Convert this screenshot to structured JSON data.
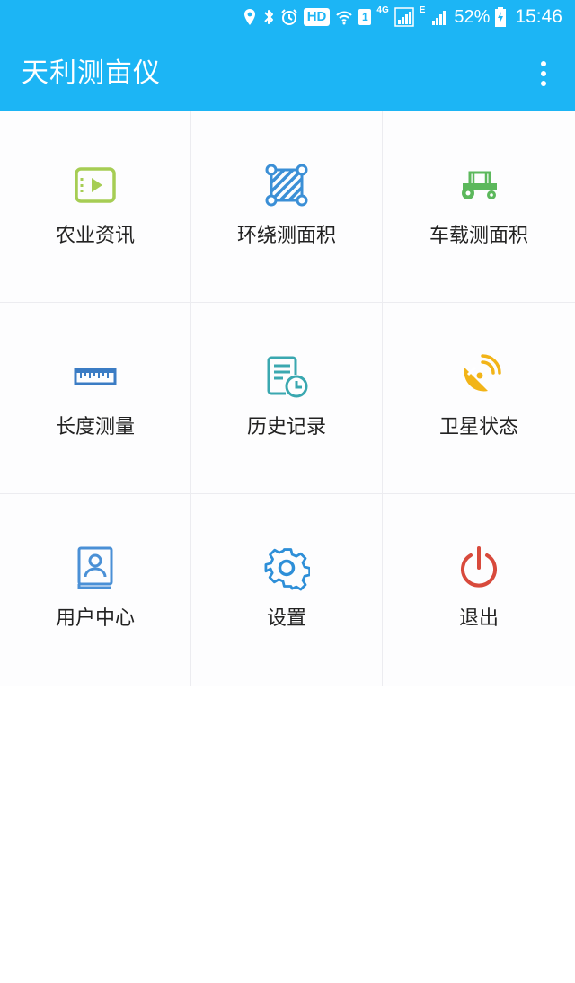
{
  "status_bar": {
    "hd": "HD",
    "sim": "1",
    "network_4g": "4G",
    "network_e": "E",
    "battery": "52%",
    "time": "15:46"
  },
  "app_bar": {
    "title": "天利测亩仪",
    "menu_icon": "more-vertical-icon"
  },
  "menu": {
    "items": [
      {
        "label": "农业资讯",
        "icon": "video-play-icon",
        "color": "#a6cd54"
      },
      {
        "label": "环绕测面积",
        "icon": "area-polygon-icon",
        "color": "#3b8fd6"
      },
      {
        "label": "车载测面积",
        "icon": "tractor-icon",
        "color": "#5cb85c"
      },
      {
        "label": "长度测量",
        "icon": "ruler-icon",
        "color": "#3b7cc4"
      },
      {
        "label": "历史记录",
        "icon": "history-record-icon",
        "color": "#3aa8b0"
      },
      {
        "label": "卫星状态",
        "icon": "satellite-dish-icon",
        "color": "#f2b418"
      },
      {
        "label": "用户中心",
        "icon": "user-profile-icon",
        "color": "#4a90d6"
      },
      {
        "label": "设置",
        "icon": "gear-icon",
        "color": "#2e8fd8"
      },
      {
        "label": "退出",
        "icon": "power-icon",
        "color": "#d84a3c"
      }
    ]
  }
}
